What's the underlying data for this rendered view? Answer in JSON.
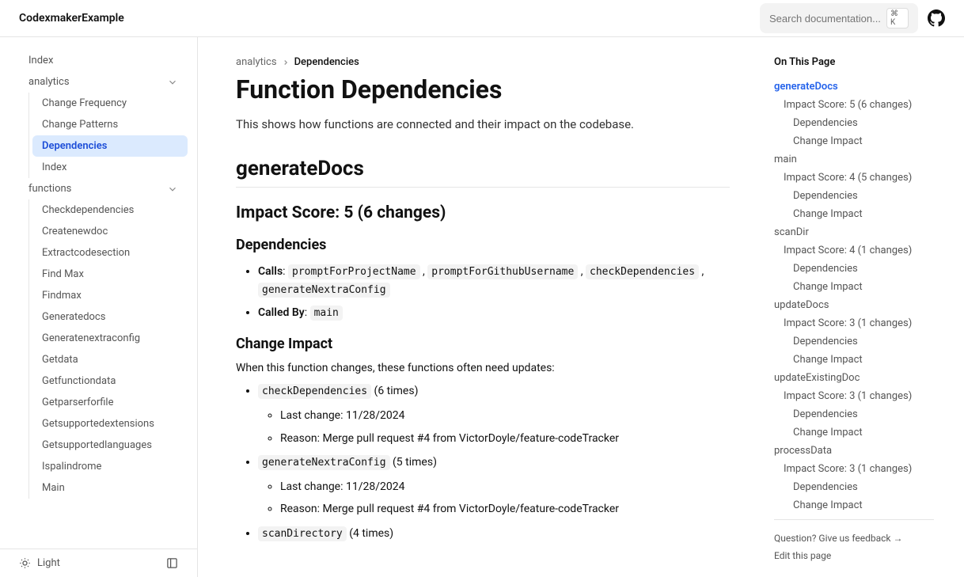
{
  "header": {
    "brand": "CodexmakerExample",
    "search_placeholder": "Search documentation...",
    "search_kbd": "⌘ K"
  },
  "sidebar": {
    "items": [
      {
        "label": "Index",
        "type": "item"
      },
      {
        "label": "analytics",
        "type": "group"
      },
      {
        "label": "Change Frequency",
        "type": "sub"
      },
      {
        "label": "Change Patterns",
        "type": "sub"
      },
      {
        "label": "Dependencies",
        "type": "sub",
        "active": true
      },
      {
        "label": "Index",
        "type": "sub"
      },
      {
        "label": "functions",
        "type": "group"
      },
      {
        "label": "Checkdependencies",
        "type": "sub"
      },
      {
        "label": "Createnewdoc",
        "type": "sub"
      },
      {
        "label": "Extractcodesection",
        "type": "sub"
      },
      {
        "label": "Find Max",
        "type": "sub"
      },
      {
        "label": "Findmax",
        "type": "sub"
      },
      {
        "label": "Generatedocs",
        "type": "sub"
      },
      {
        "label": "Generatenextraconfig",
        "type": "sub"
      },
      {
        "label": "Getdata",
        "type": "sub"
      },
      {
        "label": "Getfunctiondata",
        "type": "sub"
      },
      {
        "label": "Getparserforfile",
        "type": "sub"
      },
      {
        "label": "Getsupportedextensions",
        "type": "sub"
      },
      {
        "label": "Getsupportedlanguages",
        "type": "sub"
      },
      {
        "label": "Ispalindrome",
        "type": "sub"
      },
      {
        "label": "Main",
        "type": "sub"
      }
    ],
    "footer_theme": "Light"
  },
  "breadcrumb": {
    "parent": "analytics",
    "current": "Dependencies"
  },
  "page": {
    "title": "Function Dependencies",
    "intro": "This shows how functions are connected and their impact on the codebase.",
    "section_name": "generateDocs",
    "impact_heading": "Impact Score: 5 (6 changes)",
    "deps_heading": "Dependencies",
    "calls_label": "Calls",
    "calls": [
      "promptForProjectName",
      "promptForGithubUsername",
      "checkDependencies",
      "generateNextraConfig"
    ],
    "called_by_label": "Called By",
    "called_by": [
      "main"
    ],
    "change_impact_heading": "Change Impact",
    "change_impact_desc": "When this function changes, these functions often need updates:",
    "impacts": [
      {
        "fn": "checkDependencies",
        "count": "(6 times)",
        "last_change": "Last change: 11/28/2024",
        "reason": "Reason: Merge pull request #4 from VictorDoyle/feature-codeTracker"
      },
      {
        "fn": "generateNextraConfig",
        "count": "(5 times)",
        "last_change": "Last change: 11/28/2024",
        "reason": "Reason: Merge pull request #4 from VictorDoyle/feature-codeTracker"
      },
      {
        "fn": "scanDirectory",
        "count": "(4 times)"
      }
    ]
  },
  "toc": {
    "title": "On This Page",
    "items": [
      {
        "label": "generateDocs",
        "level": 1,
        "active": true
      },
      {
        "label": "Impact Score: 5 (6 changes)",
        "level": 2
      },
      {
        "label": "Dependencies",
        "level": 3
      },
      {
        "label": "Change Impact",
        "level": 3
      },
      {
        "label": "main",
        "level": 1
      },
      {
        "label": "Impact Score: 4 (5 changes)",
        "level": 2
      },
      {
        "label": "Dependencies",
        "level": 3
      },
      {
        "label": "Change Impact",
        "level": 3
      },
      {
        "label": "scanDir",
        "level": 1
      },
      {
        "label": "Impact Score: 4 (1 changes)",
        "level": 2
      },
      {
        "label": "Dependencies",
        "level": 3
      },
      {
        "label": "Change Impact",
        "level": 3
      },
      {
        "label": "updateDocs",
        "level": 1
      },
      {
        "label": "Impact Score: 3 (1 changes)",
        "level": 2
      },
      {
        "label": "Dependencies",
        "level": 3
      },
      {
        "label": "Change Impact",
        "level": 3
      },
      {
        "label": "updateExistingDoc",
        "level": 1
      },
      {
        "label": "Impact Score: 3 (1 changes)",
        "level": 2
      },
      {
        "label": "Dependencies",
        "level": 3
      },
      {
        "label": "Change Impact",
        "level": 3
      },
      {
        "label": "processData",
        "level": 1
      },
      {
        "label": "Impact Score: 3 (1 changes)",
        "level": 2
      },
      {
        "label": "Dependencies",
        "level": 3
      },
      {
        "label": "Change Impact",
        "level": 3
      }
    ],
    "feedback": "Question? Give us feedback →",
    "edit": "Edit this page"
  }
}
